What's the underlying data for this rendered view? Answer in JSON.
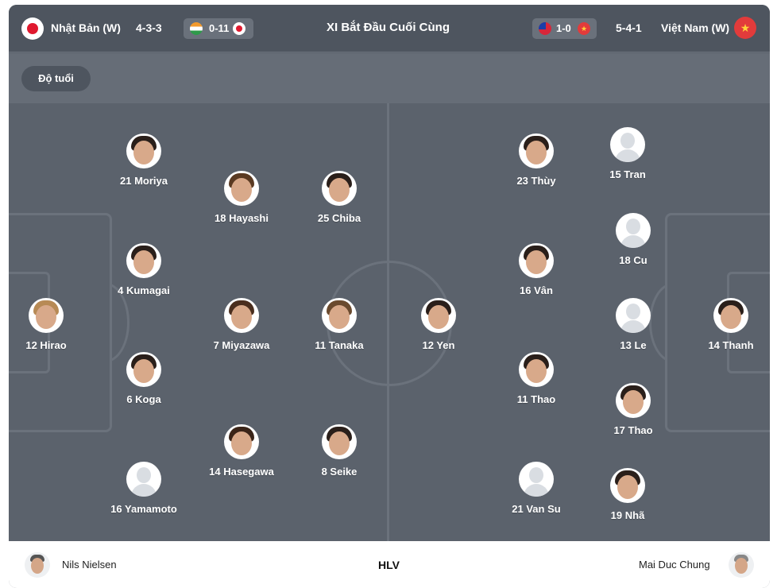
{
  "header": {
    "home_team": "Nhật Bản (W)",
    "home_formation": "4-3-3",
    "home_last_score": "0-11",
    "title": "XI Bắt Đầu Cuối Cùng",
    "away_last_score": "1-0",
    "away_formation": "5-4-1",
    "away_team": "Việt Nam (W)",
    "vn_star": "★"
  },
  "toolbar": {
    "age_button": "Độ tuổi"
  },
  "home_players": [
    {
      "label": "21 Moriya"
    },
    {
      "label": "4 Kumagai"
    },
    {
      "label": "12 Hirao"
    },
    {
      "label": "6 Koga"
    },
    {
      "label": "16 Yamamoto"
    },
    {
      "label": "18 Hayashi"
    },
    {
      "label": "7 Miyazawa"
    },
    {
      "label": "14 Hasegawa"
    },
    {
      "label": "25 Chiba"
    },
    {
      "label": "11 Tanaka"
    },
    {
      "label": "8 Seike"
    }
  ],
  "away_players": [
    {
      "label": "12 Yen"
    },
    {
      "label": "23 Thùy"
    },
    {
      "label": "16 Vân"
    },
    {
      "label": "11 Thao"
    },
    {
      "label": "21 Van Su"
    },
    {
      "label": "15 Tran"
    },
    {
      "label": "18 Cu"
    },
    {
      "label": "13 Le"
    },
    {
      "label": "17 Thao"
    },
    {
      "label": "19 Nhã"
    },
    {
      "label": "14 Thanh"
    }
  ],
  "coaches": {
    "home": "Nils Nielsen",
    "label": "HLV",
    "away": "Mai Duc Chung"
  },
  "colors": {
    "pitch": "#5b626c",
    "header": "#4e555f",
    "line": "#6b727c",
    "japan_red": "#e0192f",
    "vietnam_red": "#e23b3b"
  }
}
